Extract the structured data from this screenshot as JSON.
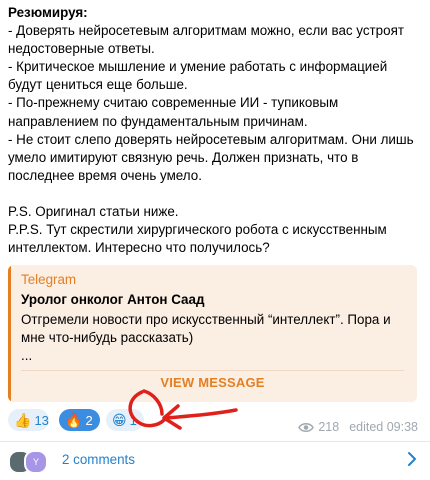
{
  "post": {
    "heading": "Резюмируя:",
    "lines": [
      "- Доверять нейросетевым алгоритмам можно, если вас устроят недостоверные ответы.",
      "- Критическое мышление и умение работать с информацией будут цениться еще больше.",
      "- По-прежнему считаю современные ИИ - тупиковым направлением по фундаментальным причинам.",
      "- Не стоит слепо доверять нейросетевым алгоритмам. Они лишь умело имитируют связную речь. Должен признать, что в последнее время очень умело."
    ],
    "ps": "P.S. Оригинал статьи ниже.",
    "pps": "P.P.S. Тут скрестили хирургического робота с искусственным интеллектом. Интересно что получилось?"
  },
  "forward": {
    "source": "Telegram",
    "author": "Уролог онколог Антон Саад",
    "body": "Отгремели новости про искусственный “интеллект”. Пора и мне что-нибудь рассказать)",
    "ellipsis": "...",
    "view_label": "VIEW MESSAGE",
    "accent": "#e67e22"
  },
  "reactions": [
    {
      "emoji": "👍",
      "count": "13",
      "active": false
    },
    {
      "emoji": "🔥",
      "count": "2",
      "active": true
    },
    {
      "emoji": "😁",
      "count": "1",
      "active": false
    }
  ],
  "meta": {
    "views": "218",
    "edited": "edited 09:38",
    "icon": "eye-icon"
  },
  "comments": {
    "label": "2 comments",
    "avatar2_initial": "Y"
  },
  "colors": {
    "link": "#2481cc",
    "annotation_arrow": "#e0201b"
  }
}
